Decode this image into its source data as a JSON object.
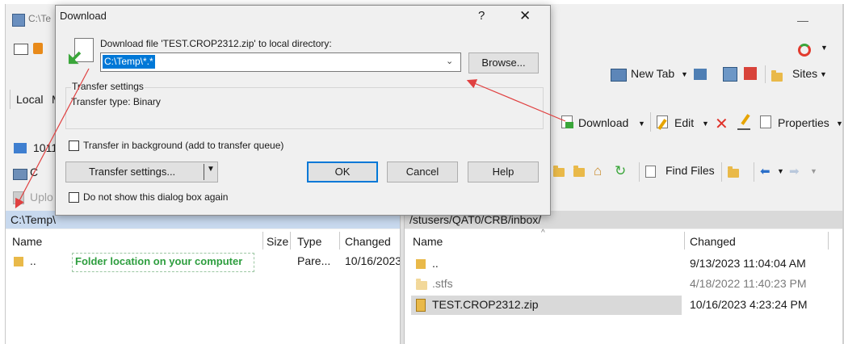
{
  "window": {
    "title_fragment": "C:\\Te",
    "minimize_glyph": "—"
  },
  "toolbar": {
    "local_label": "Local",
    "local_label2": "M",
    "new_tab_label": "New Tab",
    "sites_label": "Sites",
    "download_label": "Download",
    "edit_label": "Edit",
    "properties_label": "Properties",
    "find_files_label": "Find Files",
    "drive_label": "C",
    "upload_fragment": "Uplo",
    "session_fragment": "1011"
  },
  "left_panel": {
    "path": "C:\\Temp\\",
    "columns": [
      "Name",
      "Size",
      "Type",
      "Changed"
    ],
    "rows": [
      {
        "name": "..",
        "size": "",
        "type": "Pare...",
        "changed": "10/16/2023"
      }
    ]
  },
  "right_panel": {
    "path": "/stusers/QAT0/CRB/inbox/",
    "columns": [
      "Name",
      "Changed"
    ],
    "rows": [
      {
        "name": "..",
        "changed": "9/13/2023 11:04:04 AM",
        "muted": false,
        "selected": false
      },
      {
        "name": ".stfs",
        "changed": "4/18/2022 11:40:23 PM",
        "muted": true,
        "selected": false
      },
      {
        "name": "TEST.CROP2312.zip",
        "changed": "10/16/2023 4:23:24 PM",
        "muted": false,
        "selected": true
      }
    ]
  },
  "annotation": {
    "text": "Folder location on your computer",
    "color": "#2e9e3f",
    "arrow_color": "#e04040"
  },
  "dialog": {
    "title": "Download",
    "help_glyph": "?",
    "close_glyph": "✕",
    "prompt": "Download file 'TEST.CROP2312.zip' to local directory:",
    "directory_value": "C:\\Temp\\*.*",
    "browse_label": "Browse...",
    "group_title": "Transfer settings",
    "transfer_type": "Transfer type: Binary",
    "background_label": "Transfer in background (add to transfer queue)",
    "transfer_settings_button": "Transfer settings...",
    "ok_label": "OK",
    "cancel_label": "Cancel",
    "help_label": "Help",
    "dont_show_label": "Do not show this dialog box again",
    "selection_color": "#0078d7"
  }
}
